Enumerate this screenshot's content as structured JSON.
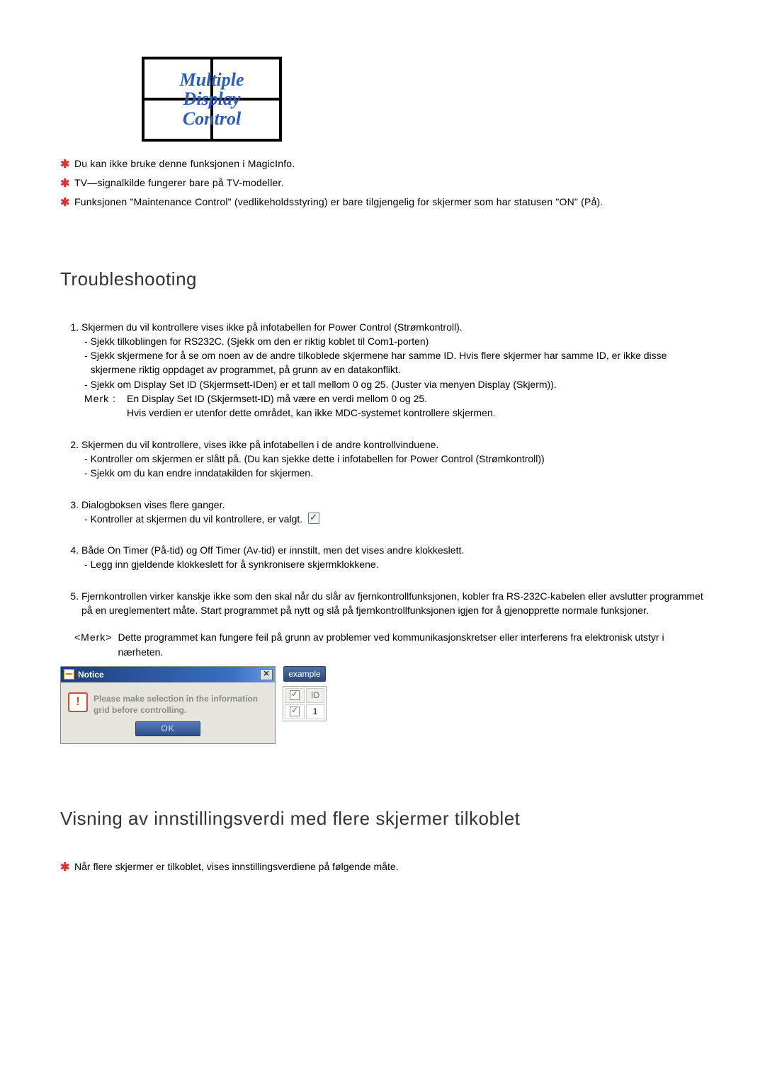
{
  "logo": {
    "line1": "Multiple",
    "line2": "Display",
    "line3": "Control"
  },
  "top_notes": [
    "Du kan ikke bruke denne funksjonen i MagicInfo.",
    "TV—signalkilde fungerer bare på TV-modeller.",
    "Funksjonen \"Maintenance Control\" (vedlikeholdsstyring) er bare tilgjengelig for skjermer som har statusen \"ON\" (På)."
  ],
  "troubleshooting": {
    "title": "Troubleshooting",
    "items": [
      {
        "lead": "Skjermen du vil kontrollere vises ikke på infotabellen for Power Control (Strømkontroll).",
        "subs": [
          "Sjekk tilkoblingen for RS232C. (Sjekk om den er riktig koblet til Com1-porten)",
          "Sjekk skjermene for å se om noen av de andre tilkoblede skjermene har samme ID. Hvis flere skjermer har samme ID, er ikke disse skjermene riktig oppdaget av programmet, på grunn av en datakonflikt.",
          "Sjekk om Display Set ID (Skjermsett-IDen) er et tall mellom 0 og 25. (Juster via menyen Display (Skjerm))."
        ],
        "merk_label": "Merk :",
        "merk_text": "En Display Set ID (Skjermsett-ID) må være en verdi mellom 0 og 25.\nHvis verdien er utenfor dette området, kan ikke MDC-systemet kontrollere skjermen."
      },
      {
        "lead": "Skjermen du vil kontrollere, vises ikke på infotabellen i de andre kontrollvinduene.",
        "subs": [
          "Kontroller om skjermen er slått på. (Du kan sjekke dette i infotabellen for Power Control (Strømkontroll))",
          "Sjekk om du kan endre inndatakilden for skjermen."
        ]
      },
      {
        "lead": "Dialogboksen vises flere ganger.",
        "subs_with_icon": [
          "Kontroller at skjermen du vil kontrollere, er valgt."
        ]
      },
      {
        "lead": "Både On Timer (På-tid) og Off Timer (Av-tid) er innstilt, men det vises andre klokkeslett.",
        "subs": [
          "Legg inn gjeldende klokkeslett for å synkronisere skjermklokkene."
        ]
      },
      {
        "lead": "Fjernkontrollen virker kanskje ikke som den skal når du slår av fjernkontrollfunksjonen, kobler fra RS-232C-kabelen eller avslutter programmet på en ureglementert måte. Start programmet på nytt og slå på fjernkontrollfunksjonen igjen for å gjenopprette normale funksjoner."
      }
    ],
    "final_note_label": "<Merk>",
    "final_note_text": "Dette programmet kan fungere feil på grunn av problemer ved kommunikasjonskretser eller interferens fra elektronisk utstyr i nærheten."
  },
  "dialog": {
    "title": "Notice",
    "message": "Please make selection in the information grid before controlling.",
    "ok": "OK",
    "side_label": "example",
    "table_header": "ID",
    "table_value": "1"
  },
  "second_section_title": "Visning av innstillingsverdi med flere skjermer tilkoblet",
  "bottom_note": "Når flere skjermer er tilkoblet, vises innstillingsverdiene på følgende måte."
}
